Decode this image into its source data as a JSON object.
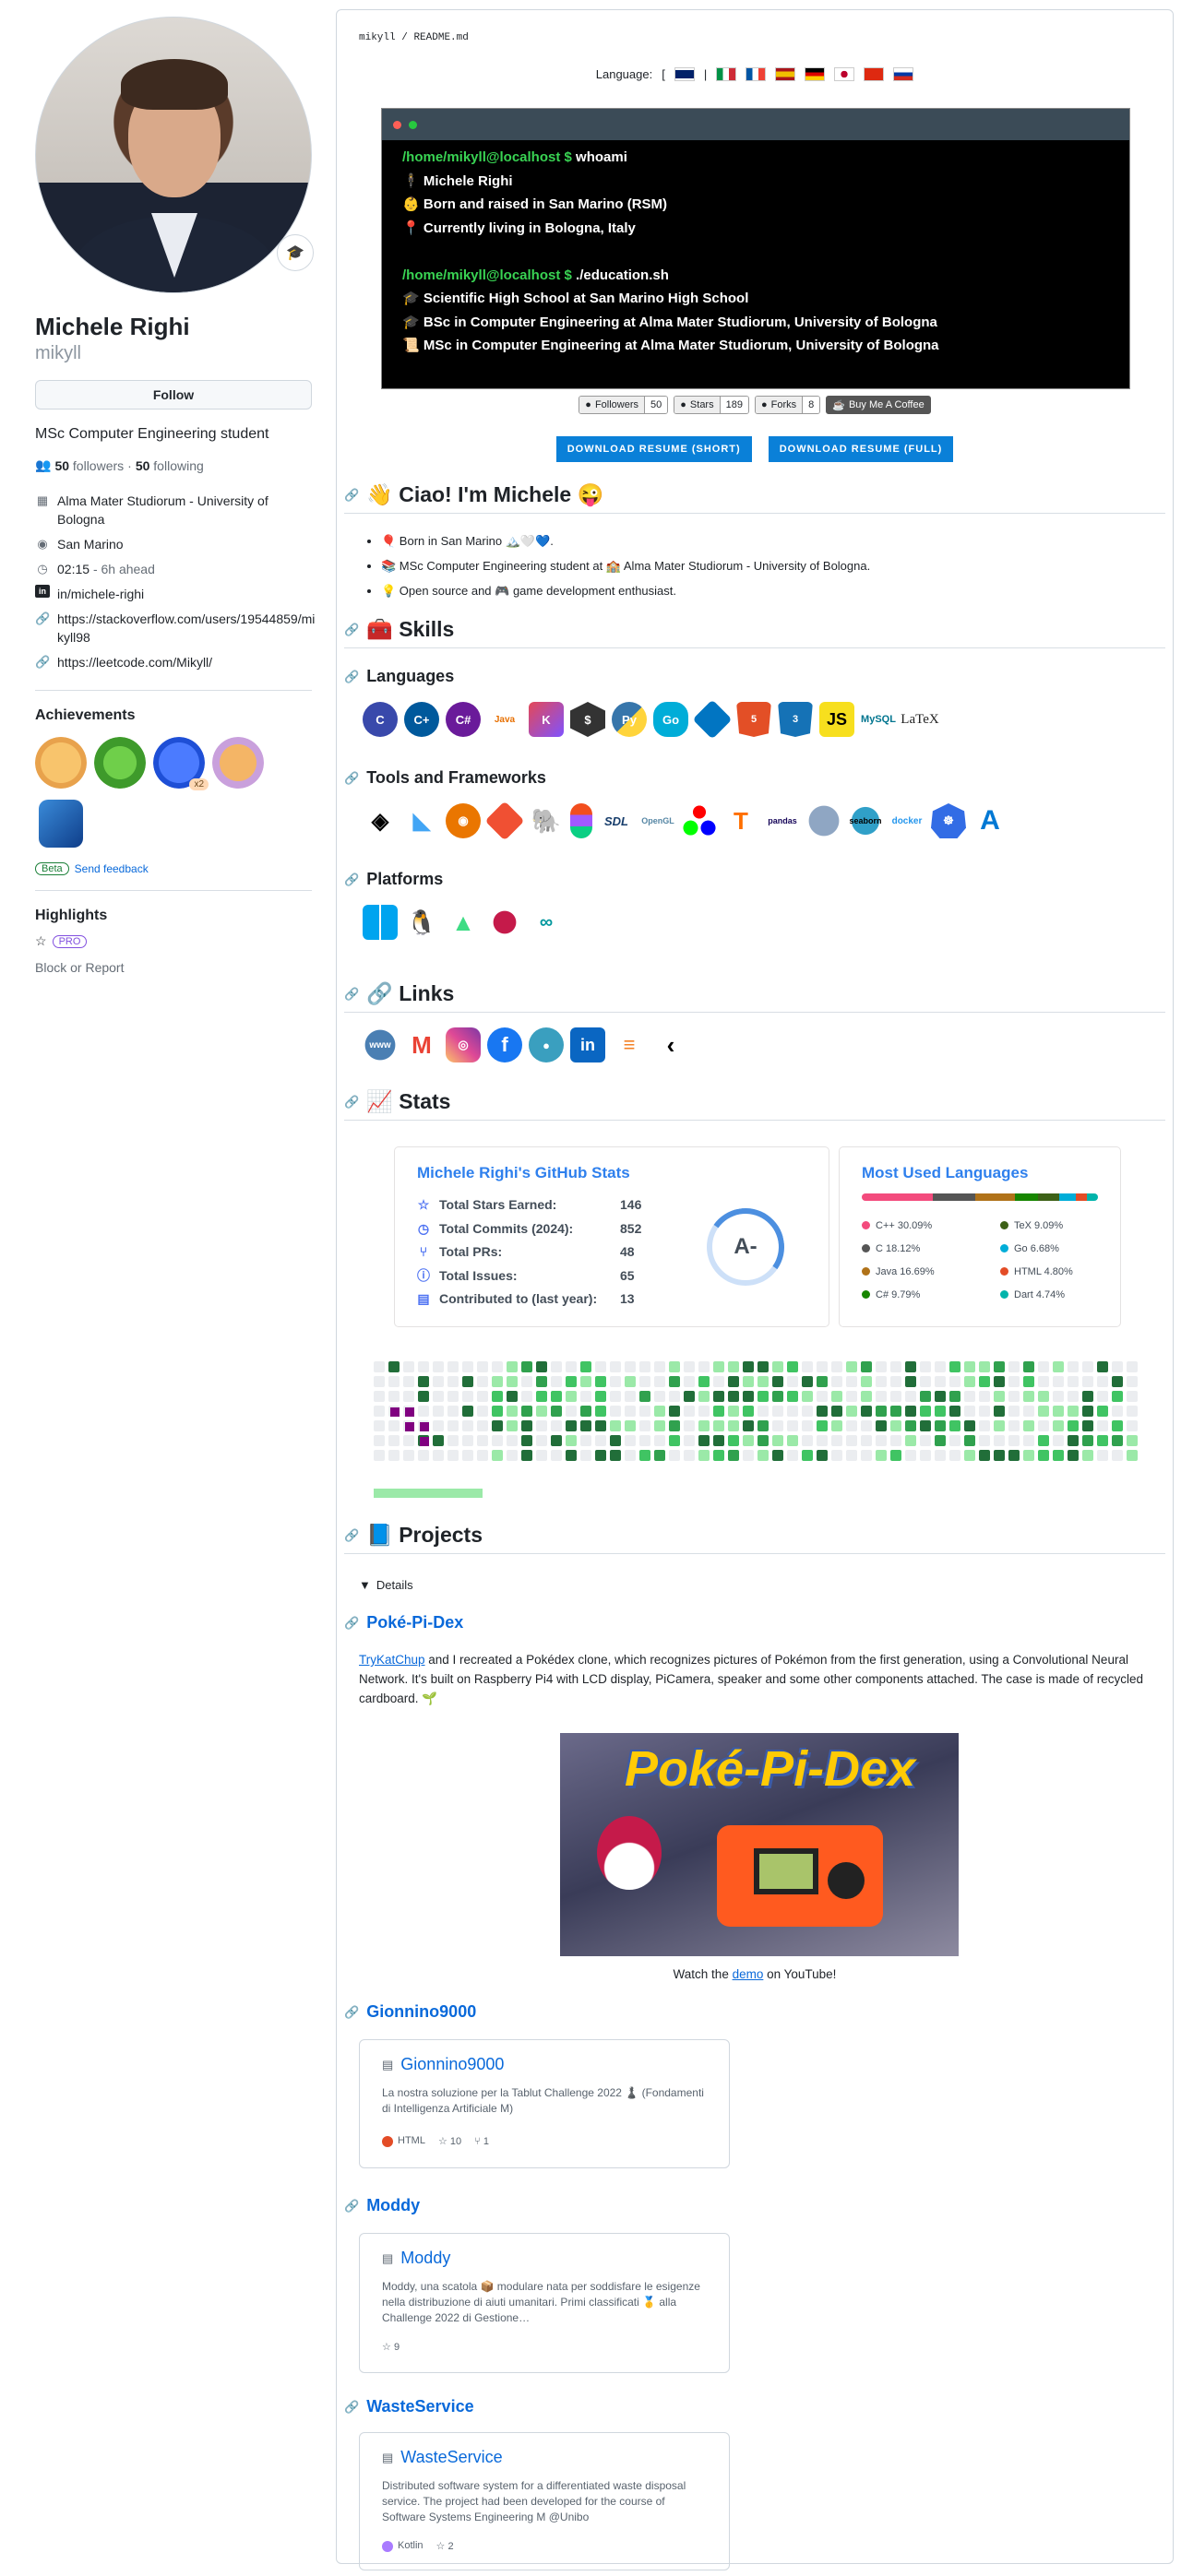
{
  "profile": {
    "full_name": "Michele Righi",
    "login": "mikyll",
    "follow_label": "Follow",
    "bio": "MSc Computer Engineering student",
    "followers_count": "50",
    "followers_label": "followers",
    "following_count": "50",
    "following_label": "following",
    "status_emoji": "🎓",
    "vcard": [
      {
        "icon": "building-icon",
        "text": "Alma Mater Studiorum - University of Bologna"
      },
      {
        "icon": "location-icon",
        "text": "San Marino"
      },
      {
        "icon": "clock-icon",
        "text": "02:15",
        "extra": "- 6h ahead"
      },
      {
        "icon": "linkedin-icon",
        "text": "in/michele-righi"
      },
      {
        "icon": "link-icon",
        "text": "https://stackoverflow.com/users/19544859/mikyll98"
      },
      {
        "icon": "link-icon",
        "text": "https://leetcode.com/Mikyll/"
      }
    ],
    "achievements_title": "Achievements",
    "achievement_multiplier": "x2",
    "beta_label": "Beta",
    "feedback_label": "Send feedback",
    "highlights_title": "Highlights",
    "pro_label": "PRO",
    "block_label": "Block or Report"
  },
  "readme": {
    "breadcrumb_user": "mikyll",
    "breadcrumb_sep": "/",
    "breadcrumb_file": "README.md",
    "language_label": "Language:",
    "lang_open": "[",
    "lang_sep": "|",
    "terminal": {
      "prompt1": "/home/mikyll@localhost $",
      "cmd1": "whoami",
      "line1": "Michele Righi",
      "line2": "Born and raised in San Marino (RSM)",
      "line3": "Currently living in Bologna, Italy",
      "prompt2": "/home/mikyll@localhost $",
      "cmd2": "./education.sh",
      "edu1": "Scientific High School at San Marino High School",
      "edu2": "BSc in Computer Engineering at Alma Mater Studiorum, University of Bologna",
      "edu3": "MSc in Computer Engineering at Alma Mater Studiorum, University of Bologna"
    },
    "shields": [
      {
        "label": "Followers",
        "value": "50"
      },
      {
        "label": "Stars",
        "value": "189"
      },
      {
        "label": "Forks",
        "value": "8"
      }
    ],
    "coffee_label": "Buy Me A Coffee",
    "resume_short": "DOWNLOAD RESUME (SHORT)",
    "resume_full": "DOWNLOAD RESUME (FULL)",
    "greeting": "👋 Ciao! I'm Michele 😜",
    "bullets": [
      "🎈 Born in San Marino 🏔️🤍💙.",
      "📚 MSc Computer Engineering student at 🏫 Alma Mater Studiorum - University of Bologna.",
      "💡 Open source and 🎮 game development enthusiast."
    ],
    "skills_title": "🧰 Skills",
    "languages_title": "Languages",
    "tools_title": "Tools and Frameworks",
    "platforms_title": "Platforms",
    "links_title": "🔗 Links",
    "stats_title": "📈 Stats",
    "stats": {
      "card_title": "Michele Righi's GitHub Stats",
      "rows": [
        {
          "label": "Total Stars Earned:",
          "value": "146"
        },
        {
          "label": "Total Commits (2024):",
          "value": "852"
        },
        {
          "label": "Total PRs:",
          "value": "48"
        },
        {
          "label": "Total Issues:",
          "value": "65"
        },
        {
          "label": "Contributed to (last year):",
          "value": "13"
        }
      ],
      "grade": "A-",
      "langs_title": "Most Used Languages",
      "langs": [
        {
          "name": "C++ 30.09%",
          "color": "#f34b7d"
        },
        {
          "name": "TeX 9.09%",
          "color": "#3d6117"
        },
        {
          "name": "C 18.12%",
          "color": "#555555"
        },
        {
          "name": "Go 6.68%",
          "color": "#00add8"
        },
        {
          "name": "Java 16.69%",
          "color": "#b07219"
        },
        {
          "name": "HTML 4.80%",
          "color": "#e34c26"
        },
        {
          "name": "C# 9.79%",
          "color": "#178600"
        },
        {
          "name": "Dart 4.74%",
          "color": "#00b4ab"
        }
      ]
    },
    "projects_title": "📘 Projects",
    "details_label": "Details",
    "pokedex": {
      "title": "Poké-Pi-Dex",
      "author": "TryKatChup",
      "text": " and I recreated a Pokédex clone, which recognizes pictures of Pokémon from the first generation, using a Convolutional Neural Network. It's built on Raspberry Pi4 with LCD display, PiCamera, speaker and some other components attached. The case is made of recycled cardboard. 🌱",
      "banner": "Poké-Pi-Dex",
      "watch_pre": "Watch the ",
      "watch_link": "demo",
      "watch_post": " on YouTube!"
    },
    "repos": [
      {
        "heading": "Gionnino9000",
        "name": "Gionnino9000",
        "desc": "La nostra soluzione per la Tablut Challenge 2022 ♟️ (Fondamenti di Intelligenza Artificiale M)",
        "lang": "HTML",
        "lang_color": "#e34c26",
        "stars": "10",
        "forks": "1"
      },
      {
        "heading": "Moddy",
        "name": "Moddy",
        "desc": "Moddy, una scatola 📦 modulare nata per soddisfare le esigenze nella distribuzione di aiuti umanitari. Primi classificati 🥇 alla Challenge 2022 di Gestione…",
        "stars": "9"
      },
      {
        "heading": "WasteService",
        "name": "WasteService",
        "desc": "Distributed software system for a differentiated waste disposal service. The project had been developed for the course of Software Systems Engineering M @Unibo",
        "lang": "Kotlin",
        "lang_color": "#a97bff",
        "stars": "2"
      }
    ]
  }
}
